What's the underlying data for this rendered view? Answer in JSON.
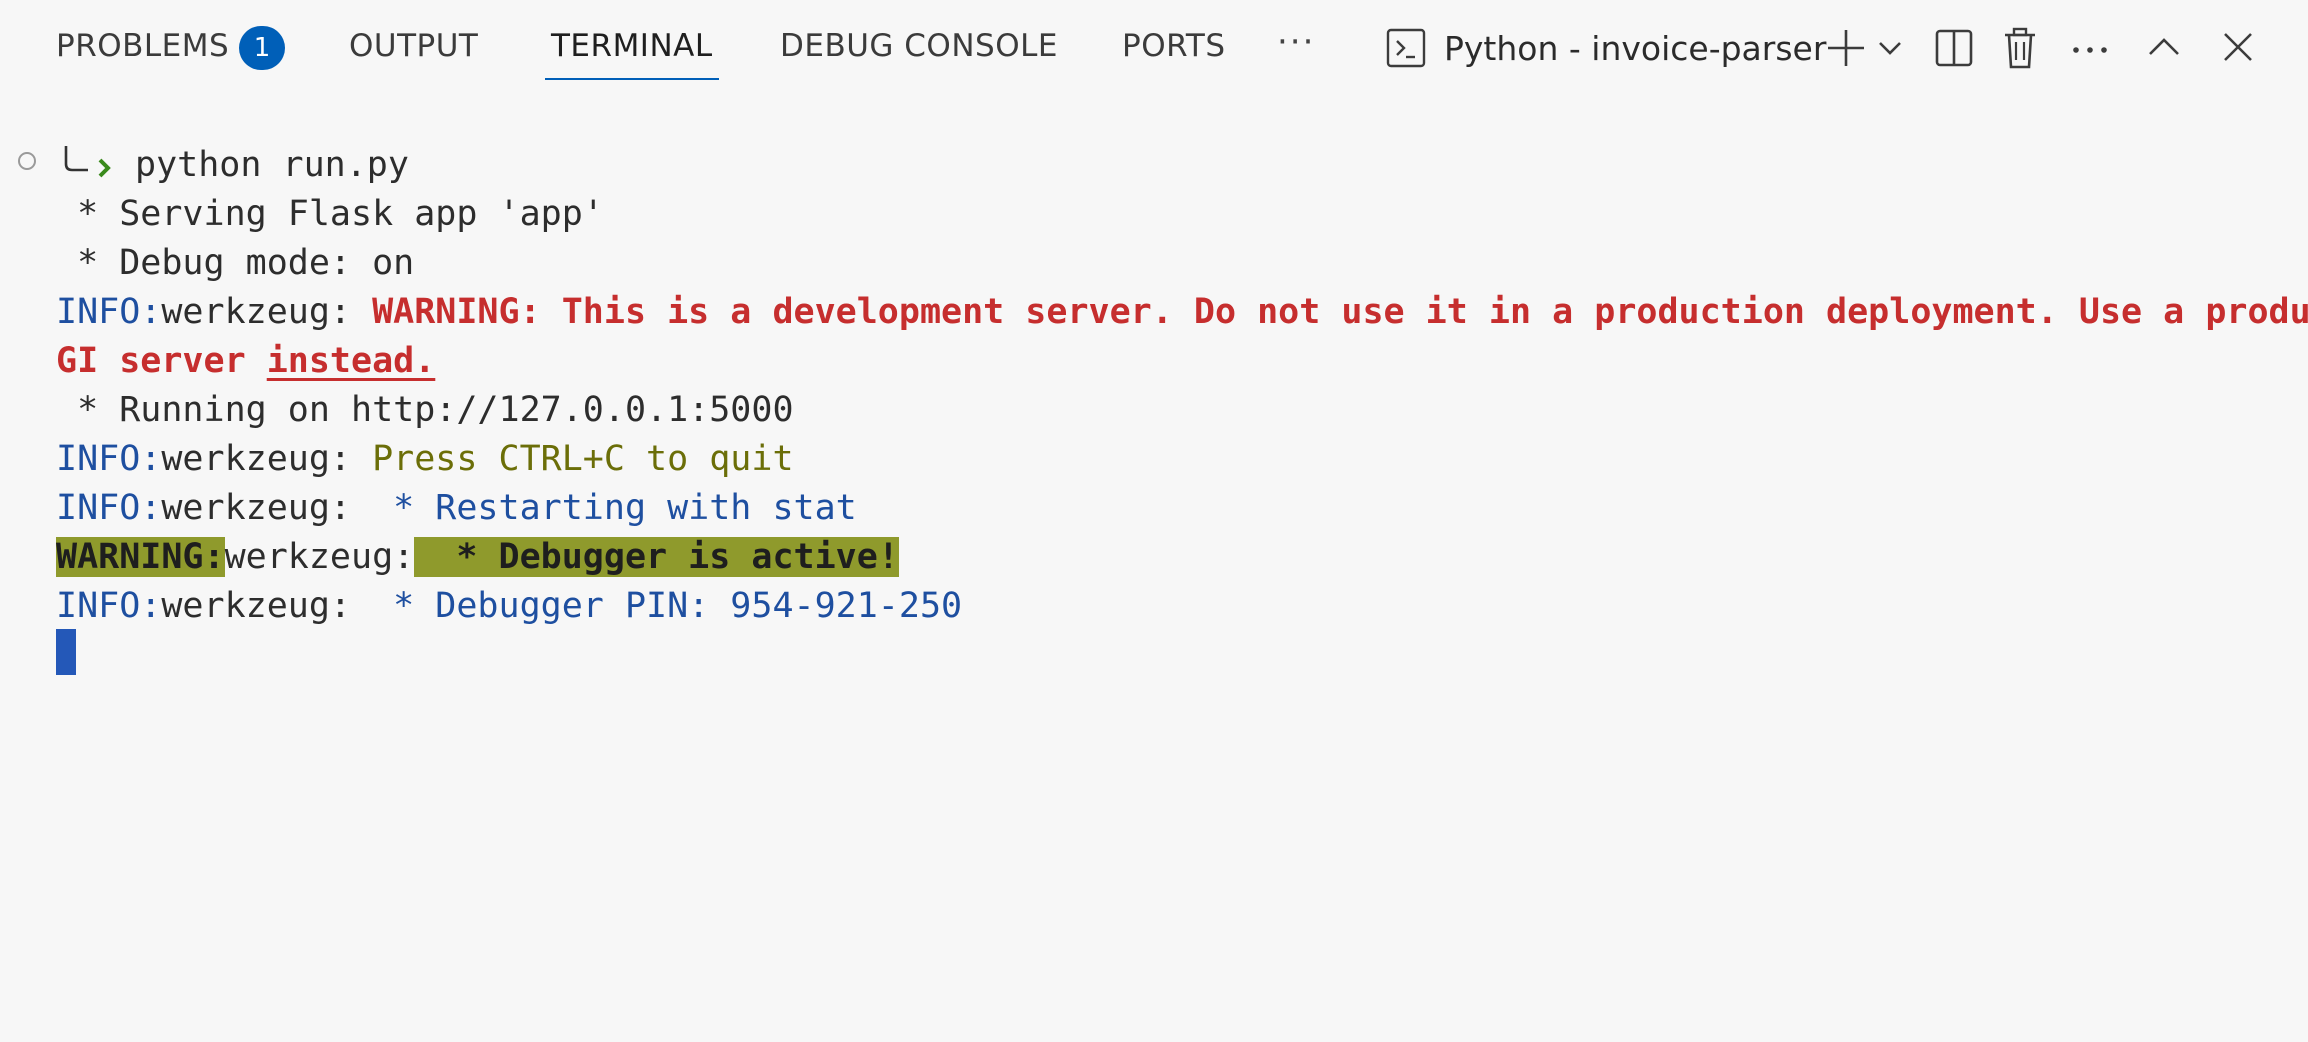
{
  "tabs": [
    {
      "label": "PROBLEMS",
      "badge": "1"
    },
    {
      "label": "OUTPUT"
    },
    {
      "label": "TERMINAL",
      "active": true
    },
    {
      "label": "DEBUG CONSOLE"
    },
    {
      "label": "PORTS"
    }
  ],
  "tab_overflow": "···",
  "terminal_select": {
    "label": "Python - invoice-parser",
    "icon": "terminal-icon"
  },
  "toolbar_icons": [
    "plus-icon",
    "chevron-down-icon",
    "split-icon",
    "trash-icon",
    "more-icon",
    "chevron-up-icon",
    "close-icon"
  ],
  "colors": {
    "accent": "#005fb8",
    "info": "#1e4fa0",
    "warning_text": "#c62e2e",
    "olive": "#6b6e08",
    "highlight_bg": "#8f9a2c",
    "prompt_arrow": "#3a8a1c"
  },
  "terminal": {
    "command": "python run.py",
    "lines": {
      "serving": " * Serving Flask app 'app'",
      "debug_mode": " * Debug mode: on",
      "info_prefix": "INFO:",
      "werkzeug": "werkzeug: ",
      "werkzeug_nospace": "werkzeug:",
      "warning_msg": "WARNING: This is a development server. Do not use it in a production deployment. Use a production",
      "warning_msg_cont_a": "GI server ",
      "warning_msg_cont_b": "instead.",
      "running_on": " * Running on http://127.0.0.1:5000",
      "press_ctrl_c": "Press CTRL+C to quit",
      "restarting": " * Restarting with stat",
      "warning_prefix": "WARNING:",
      "debugger_active": "  * Debugger is active!",
      "debugger_pin": " * Debugger PIN: 954-921-250"
    }
  }
}
